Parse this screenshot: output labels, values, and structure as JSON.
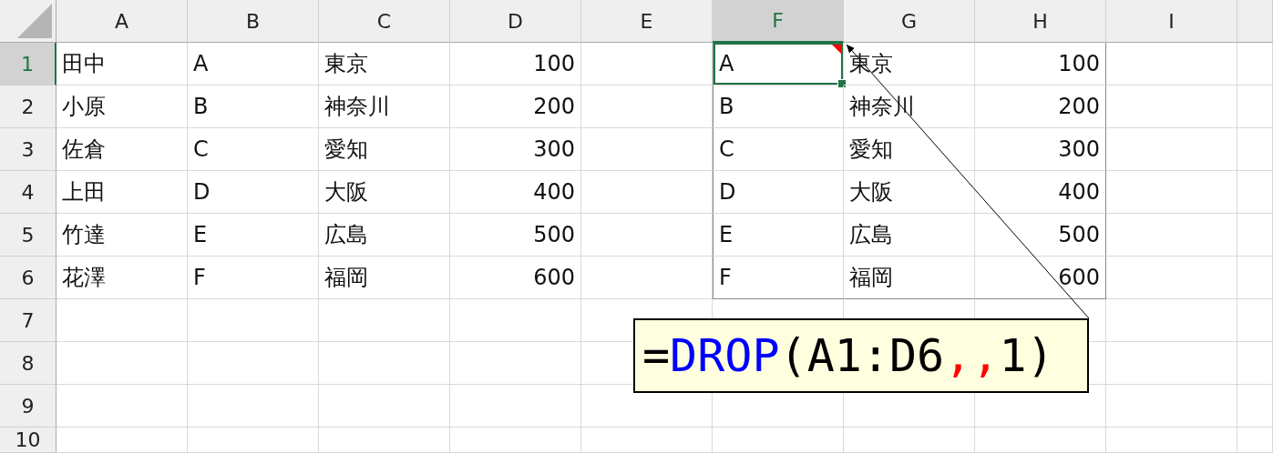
{
  "columns": [
    {
      "label": "A",
      "selected": false
    },
    {
      "label": "B",
      "selected": false
    },
    {
      "label": "C",
      "selected": false
    },
    {
      "label": "D",
      "selected": false
    },
    {
      "label": "E",
      "selected": false
    },
    {
      "label": "F",
      "selected": true
    },
    {
      "label": "G",
      "selected": false
    },
    {
      "label": "H",
      "selected": false
    },
    {
      "label": "I",
      "selected": false
    }
  ],
  "rows": [
    {
      "label": "1",
      "selected": true,
      "cells": [
        "田中",
        "A",
        "東京",
        "100"
      ],
      "spill": [
        "A",
        "東京",
        "100"
      ]
    },
    {
      "label": "2",
      "selected": false,
      "cells": [
        "小原",
        "B",
        "神奈川",
        "200"
      ],
      "spill": [
        "B",
        "神奈川",
        "200"
      ]
    },
    {
      "label": "3",
      "selected": false,
      "cells": [
        "佐倉",
        "C",
        "愛知",
        "300"
      ],
      "spill": [
        "C",
        "愛知",
        "300"
      ]
    },
    {
      "label": "4",
      "selected": false,
      "cells": [
        "上田",
        "D",
        "大阪",
        "400"
      ],
      "spill": [
        "D",
        "大阪",
        "400"
      ]
    },
    {
      "label": "5",
      "selected": false,
      "cells": [
        "竹達",
        "E",
        "広島",
        "500"
      ],
      "spill": [
        "E",
        "広島",
        "500"
      ]
    },
    {
      "label": "6",
      "selected": false,
      "cells": [
        "花澤",
        "F",
        "福岡",
        "600"
      ],
      "spill": [
        "F",
        "福岡",
        "600"
      ]
    },
    {
      "label": "7",
      "selected": false
    },
    {
      "label": "8",
      "selected": false
    },
    {
      "label": "9",
      "selected": false
    },
    {
      "label": "10",
      "selected": false
    }
  ],
  "active_cell_comment": true,
  "callout": {
    "parts": [
      {
        "text": "=",
        "color": "#000000"
      },
      {
        "text": "DROP",
        "color": "#0000ff"
      },
      {
        "text": "(A1:D6",
        "color": "#000000"
      },
      {
        "text": ",,",
        "color": "#ff0000"
      },
      {
        "text": "1)",
        "color": "#000000"
      }
    ]
  }
}
